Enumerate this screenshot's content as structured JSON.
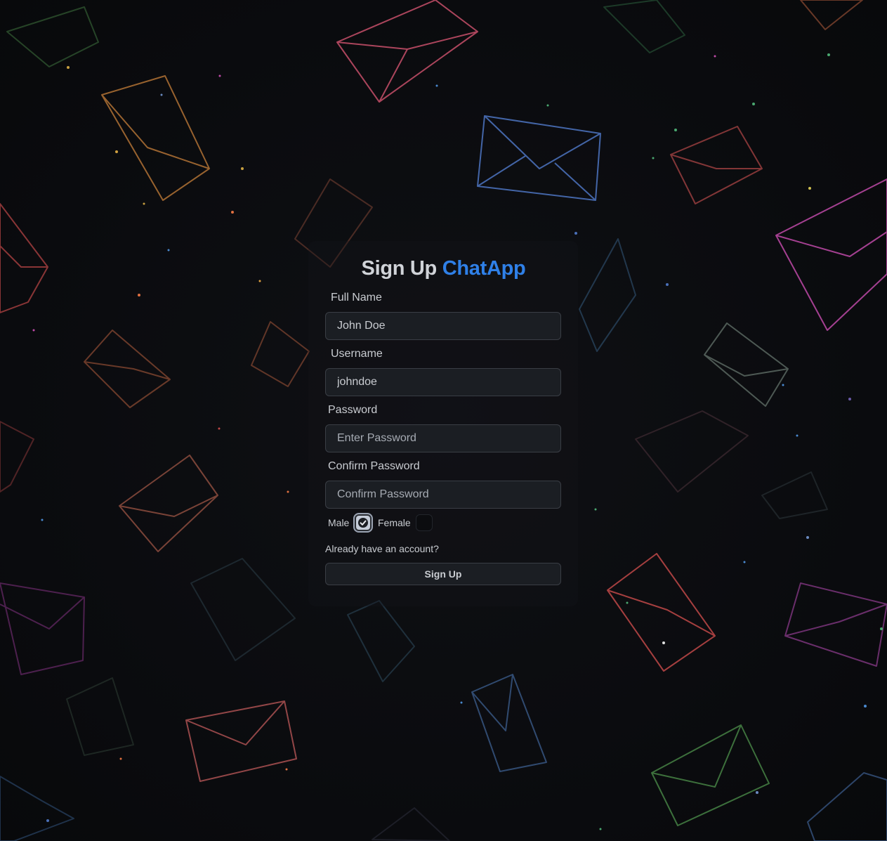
{
  "page": {
    "title_prefix": "Sign Up",
    "title_brand": "ChatApp"
  },
  "form": {
    "full_name": {
      "label": "Full Name",
      "value": "John Doe"
    },
    "username": {
      "label": "Username",
      "value": "johndoe"
    },
    "password": {
      "label": "Password",
      "placeholder": "Enter Password"
    },
    "confirm_password": {
      "label": "Confirm Password",
      "placeholder": "Confirm Password"
    },
    "gender": {
      "male_label": "Male",
      "female_label": "Female",
      "male_checked": true,
      "female_checked": false
    },
    "login_link": "Already have an account?",
    "submit_label": "Sign Up"
  },
  "theme": {
    "brand_color": "#2f80e8",
    "background": "#0b0c0f"
  }
}
